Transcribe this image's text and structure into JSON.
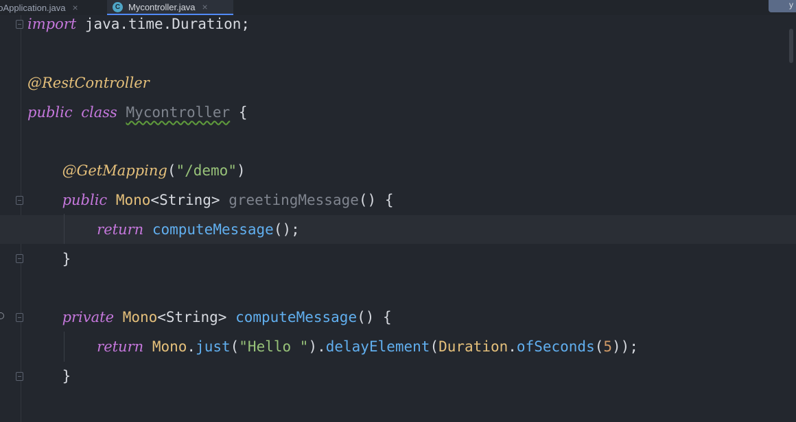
{
  "tabs": [
    {
      "label": "noApplication.java",
      "active": false,
      "close": "×"
    },
    {
      "label": "Mycontroller.java",
      "active": true,
      "icon": "class-icon",
      "icon_letter": "C",
      "close": "×"
    }
  ],
  "corner_label": "y",
  "editor": {
    "import": {
      "kw": "import",
      "rest": " java.time.Duration;"
    },
    "class_annotation": "@RestController",
    "class_decl": {
      "kw1": "public",
      "kw2": "class",
      "name": "Mycontroller",
      "brace": " {"
    },
    "method1_annotation": {
      "name": "@GetMapping",
      "open": "(",
      "arg": "\"/demo\"",
      "close": ")"
    },
    "method1_decl": {
      "kw": "public",
      "type": "Mono",
      "generic": "<String>",
      "name": "greetingMessage",
      "rest": "() {"
    },
    "method1_body": {
      "kw": "return",
      "call": "computeMessage",
      "rest": "();"
    },
    "method1_close": "}",
    "method2_decl": {
      "kw": "private",
      "type": "Mono",
      "generic": "<String>",
      "name": "computeMessage",
      "rest": "() {"
    },
    "method2_body": {
      "kw": "return",
      "type": "Mono",
      "dot1": ".",
      "call1": "just",
      "open1": "(",
      "str": "\"Hello \"",
      "close1": ").",
      "call2": "delayElement",
      "open2": "(",
      "type2": "Duration",
      "dot2": ".",
      "call3": "ofSeconds",
      "open3": "(",
      "num": "5",
      "close3": "));"
    },
    "method2_close": "}"
  },
  "colors": {
    "background": "#23272e",
    "keyword": "#c678dd",
    "annotation": "#e5c07b",
    "function": "#61afef",
    "string": "#98c379",
    "number": "#d19a66"
  }
}
